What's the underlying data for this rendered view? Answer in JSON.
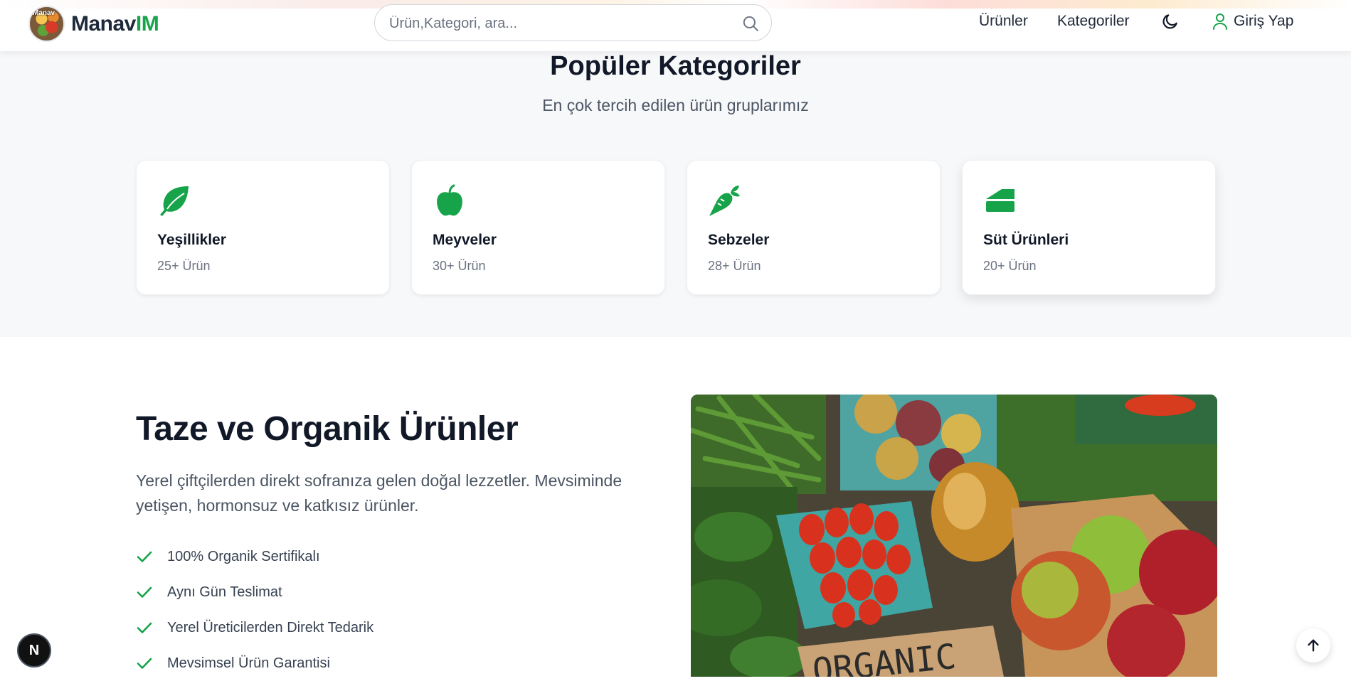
{
  "header": {
    "brand_name": "Manav",
    "brand_accent": "IM",
    "logo_text": "Manav",
    "search_placeholder": "Ürün,Kategori, ara...",
    "nav": {
      "products": "Ürünler",
      "categories": "Kategoriler"
    },
    "login_label": "Giriş Yap",
    "accent_color": "#16a34a"
  },
  "categories_section": {
    "title": "Popüler Kategoriler",
    "subtitle": "En çok tercih edilen ürün gruplarımız",
    "items": [
      {
        "name": "Yeşillikler",
        "count": "25+ Ürün",
        "icon": "leaf-icon"
      },
      {
        "name": "Meyveler",
        "count": "30+ Ürün",
        "icon": "apple-icon"
      },
      {
        "name": "Sebzeler",
        "count": "28+ Ürün",
        "icon": "carrot-icon"
      },
      {
        "name": "Süt Ürünleri",
        "count": "20+ Ürün",
        "icon": "cheese-icon"
      }
    ]
  },
  "organic_section": {
    "title": "Taze ve Organik Ürünler",
    "description": "Yerel çiftçilerden direkt sofranıza gelen doğal lezzetler. Mevsiminde yetişen, hormonsuz ve katkısız ürünler.",
    "features": [
      "100% Organik Sertifikalı",
      "Aynı Gün Teslimat",
      "Yerel Üreticilerden Direkt Tedarik",
      "Mevsimsel Ürün Garantisi"
    ],
    "photo_sign_text": "ORGANIC"
  },
  "floating": {
    "dev_badge": "N"
  }
}
